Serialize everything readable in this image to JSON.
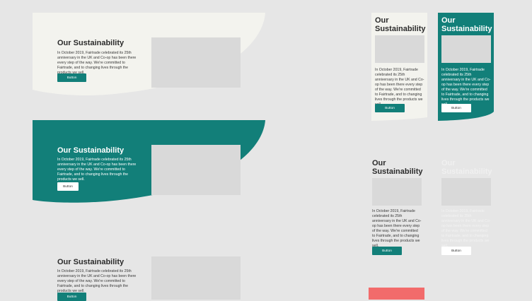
{
  "colors": {
    "page_bg": "#e6e6e6",
    "cream": "#f3f3ee",
    "teal": "#127f79",
    "placeholder": "#d9d9d9",
    "coral": "#f26b6b"
  },
  "section_title": "Our Sustainability",
  "section_title_line1": "Our",
  "section_title_line2": "Sustainability",
  "section_body": "In October 2019, Fairtrade celebrated its 25th anniversary in the UK and Co-op has been there every step of the way. We're committed to Fairtrade, and to changing lives through the products we sell.",
  "button_label": "Button"
}
